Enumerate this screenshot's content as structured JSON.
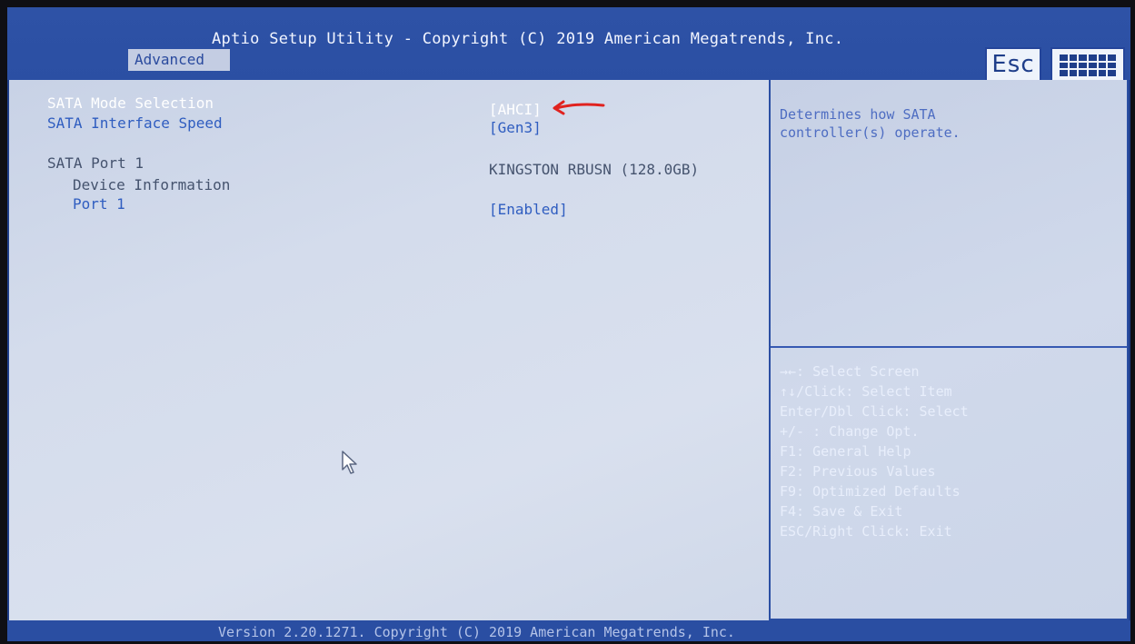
{
  "header": {
    "title": "Aptio Setup Utility - Copyright (C) 2019 American Megatrends, Inc.",
    "tab_active": "Advanced",
    "esc_label": "Esc",
    "keyboard_icon": "keyboard-icon"
  },
  "settings": [
    {
      "label": "SATA Mode Selection",
      "value": "[AHCI]",
      "highlighted": true
    },
    {
      "label": "SATA Interface Speed",
      "value": "[Gen3]",
      "highlighted": false
    },
    {
      "label": "SATA Port 1",
      "value": "KINGSTON RBUSN (128.0GB)",
      "highlighted": false
    },
    {
      "label": "Device Information",
      "value": "",
      "highlighted": false
    },
    {
      "label": "Port 1",
      "value": "[Enabled]",
      "highlighted": false
    }
  ],
  "help": {
    "description": [
      "Determines how SATA",
      "controller(s) operate."
    ],
    "keys": [
      "→←: Select Screen",
      "↑↓/Click: Select Item",
      "Enter/Dbl Click: Select",
      "+/- : Change Opt.",
      "F1: General Help",
      "F2: Previous Values",
      "F9: Optimized Defaults",
      "F4: Save & Exit",
      "ESC/Right Click: Exit"
    ]
  },
  "footer": {
    "text": "Version 2.20.1271. Copyright (C) 2019 American Megatrends, Inc."
  },
  "annotations": {
    "arrow_color": "#e0221f"
  },
  "colors": {
    "frame_blue": "#1f3e8a",
    "panel_bg": "#d4dcec",
    "selected_text": "#ffffff",
    "option_text": "#2f5dc0"
  }
}
